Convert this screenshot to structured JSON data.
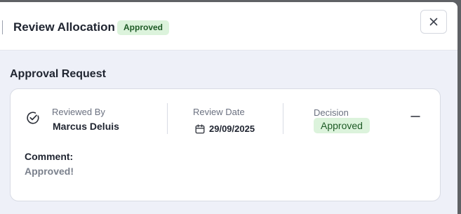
{
  "header": {
    "title": "Review Allocation",
    "status_badge": "Approved",
    "close_icon": "close-icon"
  },
  "section": {
    "title": "Approval Request"
  },
  "card": {
    "status_icon": "check-circle-icon",
    "reviewed_by": {
      "label": "Reviewed By",
      "value": "Marcus Deluis"
    },
    "review_date": {
      "label": "Review Date",
      "icon": "calendar-icon",
      "value": "29/09/2025"
    },
    "decision": {
      "label": "Decision",
      "value": "Approved"
    },
    "collapse_icon": "minus-icon",
    "comment": {
      "label": "Comment:",
      "value": "Approved!"
    }
  },
  "colors": {
    "badge_bg": "#dcf3dc",
    "badge_text": "#1d5a25",
    "background": "#eef0f8"
  }
}
